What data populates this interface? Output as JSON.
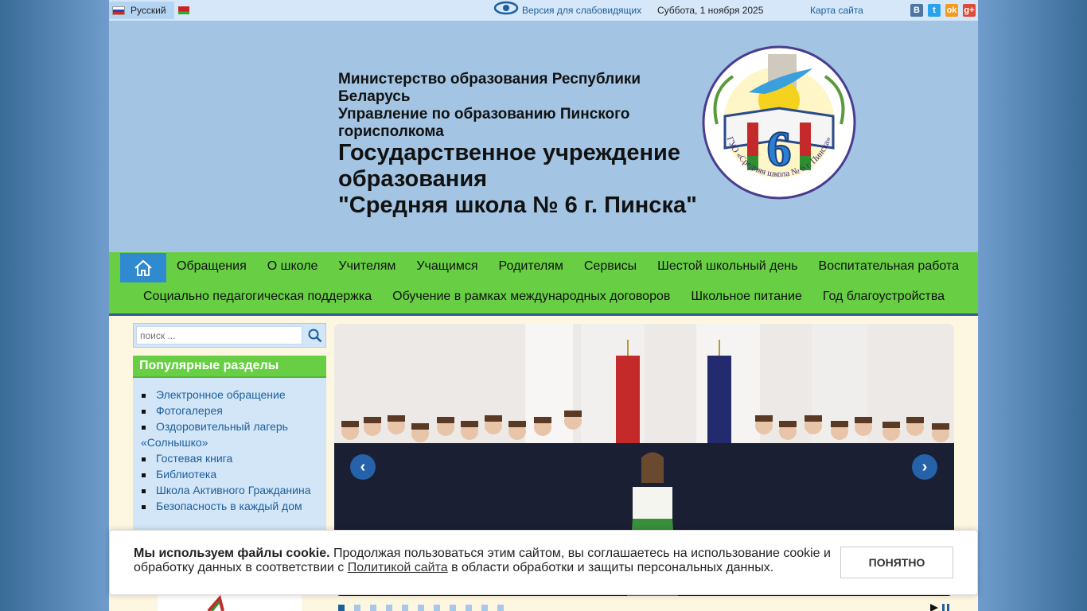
{
  "topbar": {
    "language": "Русский",
    "low_vision": "Версия для слабовидящих",
    "date": "Суббота, 1 ноября 2025",
    "sitemap": "Карта сайта",
    "social": [
      "В",
      "t",
      "ok",
      "g+"
    ]
  },
  "header": {
    "ministry": "Министерство образования Республики Беларусь",
    "department": "Управление по образованию Пинского горисполкома",
    "school_line1": "Государственное учреждение образования",
    "school_line2": "\"Средняя школа № 6 г. Пинска\"",
    "logo_number": "6",
    "logo_ring_text": "ГУО «Средняя школа № 6 г. Пинска»"
  },
  "nav": {
    "home_icon": "home-icon",
    "row1": [
      "Обращения",
      "О школе",
      "Учителям",
      "Учащимся",
      "Родителям",
      "Сервисы",
      "Шестой школьный день",
      "Воспитательная работа"
    ],
    "row2": [
      "Социально педагогическая поддержка",
      "Обучение в рамках международных договоров",
      "Школьное питание",
      "Год благоустройства"
    ]
  },
  "search": {
    "placeholder": "поиск ..."
  },
  "popular": {
    "title": "Популярные разделы",
    "items": [
      "Электронное обращение",
      "Фотогалерея",
      "Оздоровительный лагерь «Солнышко»",
      "Гостевая книга",
      "Библиотека",
      "Школа Активного Гражданина",
      "Безопасность в каждый дом"
    ]
  },
  "slider": {
    "prev": "‹",
    "next": "›",
    "slide_count": 11,
    "active_slide": 1
  },
  "cookie": {
    "bold": "Мы используем файлы cookie.",
    "text1": " Продолжая пользоваться этим сайтом, вы соглашаетесь на использование cookie и обработку данных в соответствии с ",
    "link": "Политикой сайта",
    "text2": " в области обработки и защиты персональных данных.",
    "button": "ПОНЯТНО"
  },
  "colors": {
    "nav_green": "#68cf45",
    "header_blue": "#a3c5e3",
    "link_blue": "#1d5e9c"
  }
}
